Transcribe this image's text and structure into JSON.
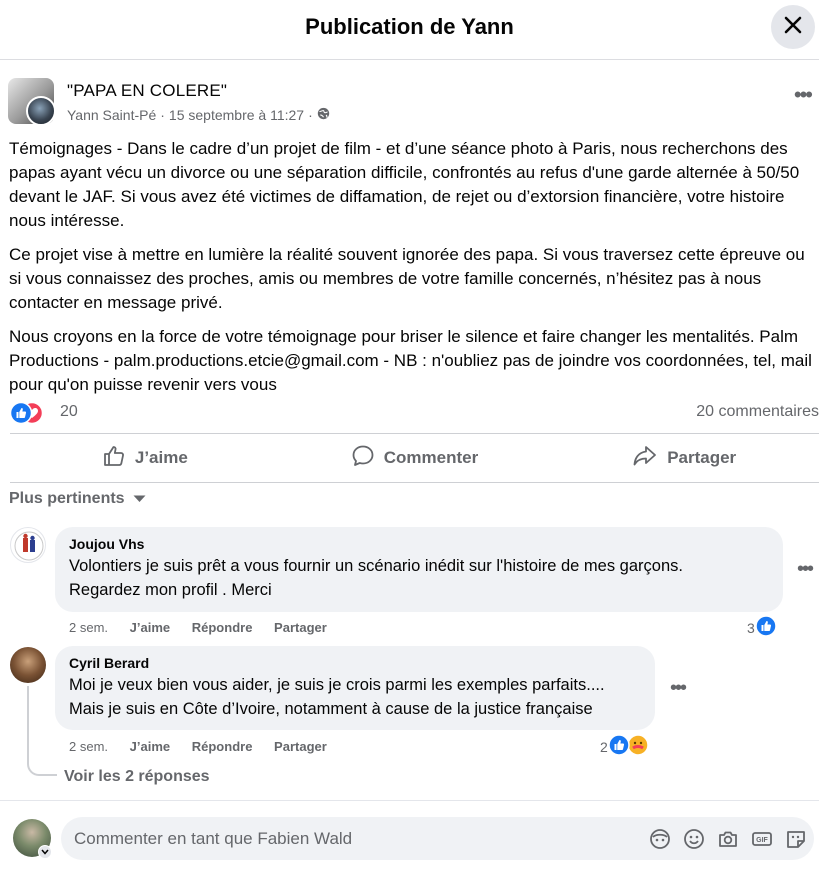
{
  "header": {
    "title": "Publication de Yann"
  },
  "post": {
    "group_name": "\"PAPA EN COLERE\"",
    "author": "Yann Saint-Pé",
    "separator": "·",
    "date": "15 septembre à 11:27",
    "body": [
      "Témoignages - Dans le cadre d’un projet de film - et d’une séance photo à Paris, nous recherchons des papas ayant vécu un divorce ou une séparation difficile, confrontés au refus d'une garde alternée à 50/50 devant le JAF. Si vous avez été victimes de diffamation, de rejet ou d’extorsion financière, votre histoire nous intéresse.",
      "Ce projet vise à mettre en lumière la réalité souvent ignorée des papa. Si vous traversez cette épreuve ou si vous connaissez des proches, amis ou membres de votre famille concernés, n’hésitez pas à nous contacter en message privé.",
      "Nous croyons en la force de votre témoignage pour briser le silence et faire changer les mentalités. Palm Productions - palm.productions.etcie@gmail.com - NB : n'oubliez pas de joindre vos coordonnées, tel, mail pour qu'on puisse revenir vers vous"
    ],
    "reaction_count": "20",
    "comment_count": "20 commentaires"
  },
  "actions": {
    "like": "J’aime",
    "comment": "Commenter",
    "share": "Partager"
  },
  "sort": {
    "label": "Plus pertinents"
  },
  "comments": [
    {
      "author": "Joujou Vhs",
      "lines": [
        "Volontiers je suis prêt a vous fournir un scénario inédit sur l'histoire de mes garçons.",
        "Regardez mon profil . Merci"
      ],
      "time": "2 sem.",
      "like": "J’aime",
      "reply": "Répondre",
      "share": "Partager",
      "reaction_count": "3"
    },
    {
      "author": "Cyril Berard",
      "lines": [
        "Moi je veux bien vous aider, je suis je crois parmi les exemples parfaits....",
        "Mais je suis en Côte d’Ivoire, notamment à cause de la justice française"
      ],
      "time": "2 sem.",
      "like": "J’aime",
      "reply": "Répondre",
      "share": "Partager",
      "reaction_count": "2"
    }
  ],
  "replies_link": "Voir les 2 réponses",
  "composer": {
    "placeholder": "Commenter en tant que Fabien Wald"
  },
  "colors": {
    "like_blue": "#1877f2",
    "love_red": "#f33e58",
    "care_yellow": "#f7b125",
    "muted": "#65676b",
    "bubble": "#f0f2f5"
  },
  "icons": [
    "close-icon",
    "globe-icon",
    "more-icon",
    "like-icon",
    "comment-icon",
    "share-icon",
    "chevron-down-icon",
    "avatar-sticker-icon",
    "emoji-icon",
    "camera-icon",
    "gif-icon",
    "sticker-icon"
  ]
}
